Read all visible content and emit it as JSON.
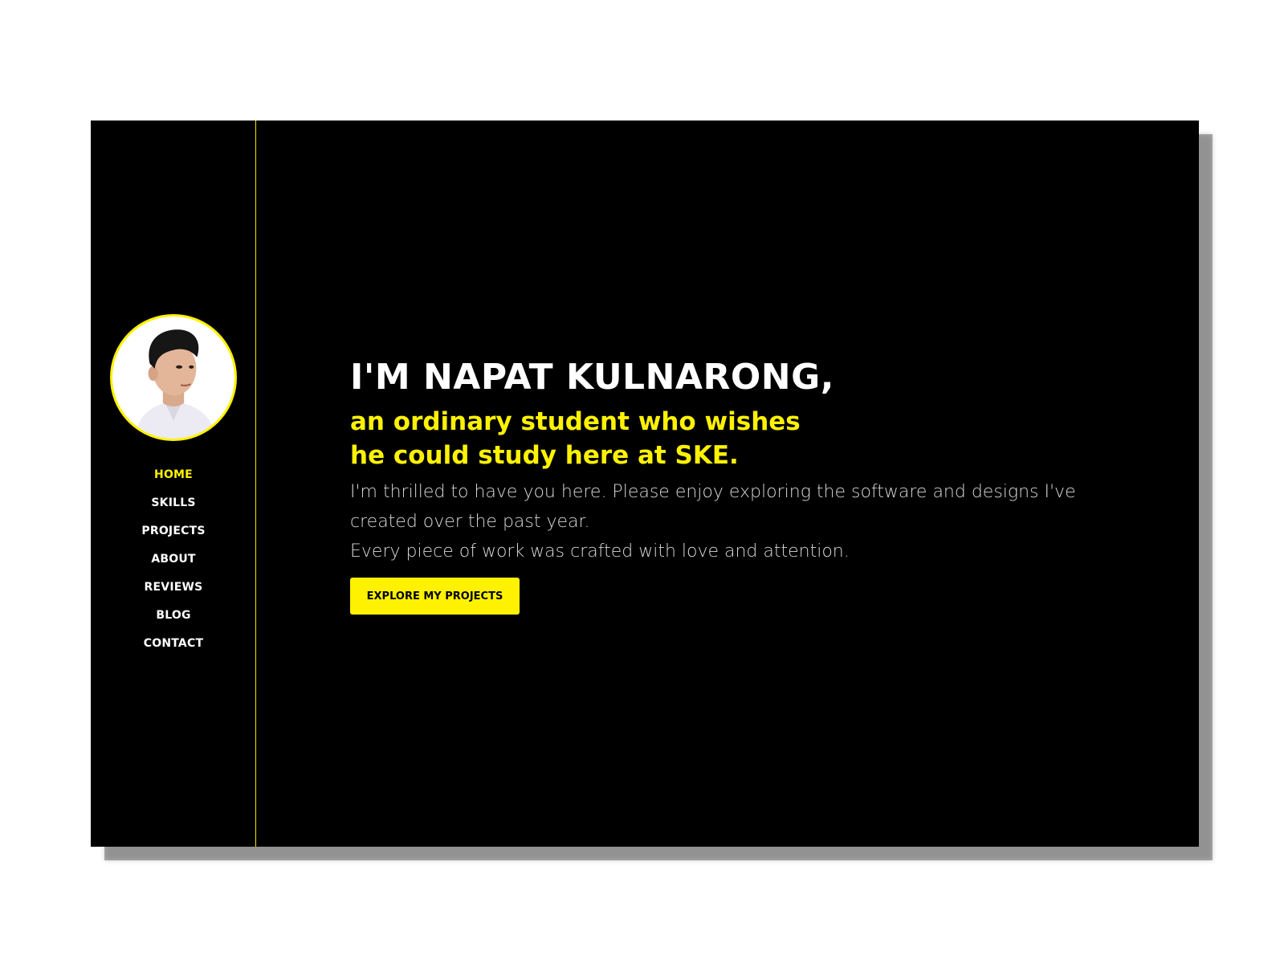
{
  "colors": {
    "accent": "#fff200",
    "background": "#000000",
    "text_primary": "#ffffff",
    "text_secondary": "#d7d7d7"
  },
  "sidebar": {
    "avatar_icon": "profile-photo",
    "nav_items": [
      {
        "label": "HOME",
        "active": true
      },
      {
        "label": "SKILLS",
        "active": false
      },
      {
        "label": "PROJECTS",
        "active": false
      },
      {
        "label": "ABOUT",
        "active": false
      },
      {
        "label": "REVIEWS",
        "active": false
      },
      {
        "label": "BLOG",
        "active": false
      },
      {
        "label": "CONTACT",
        "active": false
      }
    ]
  },
  "hero": {
    "headline": "I'M NAPAT KULNARONG,",
    "subheadline_lines": [
      "an ordinary student who wishes",
      "he could study here at SKE."
    ],
    "intro_lines": [
      "I'm thrilled to have you here. Please enjoy exploring the software and designs I've",
      "created over the past year.",
      "Every piece of work was crafted with love and attention."
    ],
    "cta_label": "EXPLORE MY PROJECTS"
  }
}
